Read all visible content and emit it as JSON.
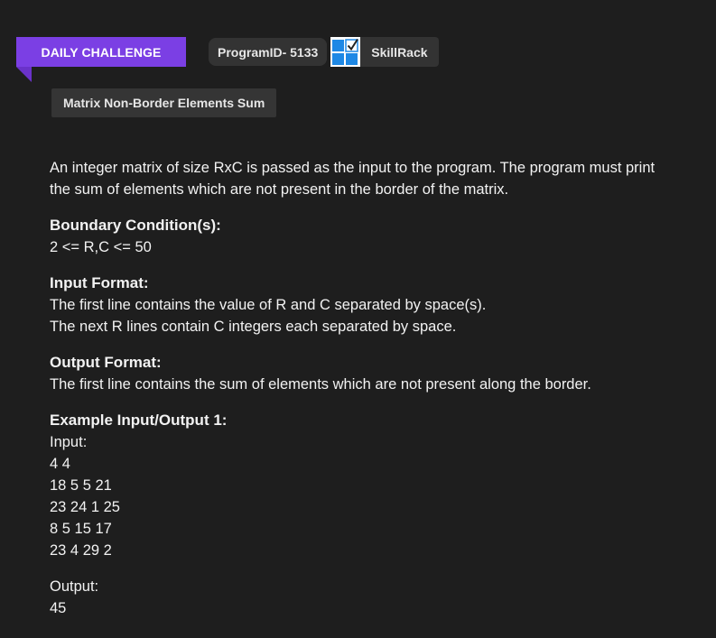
{
  "header": {
    "ribbon_label": "DAILY CHALLENGE",
    "program_id": "ProgramID- 5133",
    "brand_name": "SkillRack"
  },
  "problem": {
    "title": "Matrix Non-Border Elements Sum",
    "description_lines": [
      "An integer matrix of size RxC is passed as the input to the program. The program must print",
      "the sum of elements which are not present in the border of the matrix."
    ],
    "boundary_heading": "Boundary Condition(s):",
    "boundary_text": "2 <= R,C <= 50",
    "input_format_heading": "Input Format:",
    "input_format_lines": [
      "The first line contains the value of R and C separated by space(s).",
      "The next R lines contain C integers each separated by space."
    ],
    "output_format_heading": "Output Format:",
    "output_format_text": "The first line contains the sum of elements which are not present along the border.",
    "example_heading": "Example Input/Output 1:",
    "input_label": "Input:",
    "input_lines": [
      "4 4",
      "18 5 5 21",
      "23 24 1 25",
      "8 5 15 17",
      "23 4 29 2"
    ],
    "output_label": "Output:",
    "output_value": "45"
  },
  "colors": {
    "background": "#1e1e1e",
    "ribbon": "#7b3fe4",
    "chip": "#333333",
    "logo_blue": "#1e88e5"
  },
  "icons": {
    "logo": "skillrack-logo-icon"
  }
}
